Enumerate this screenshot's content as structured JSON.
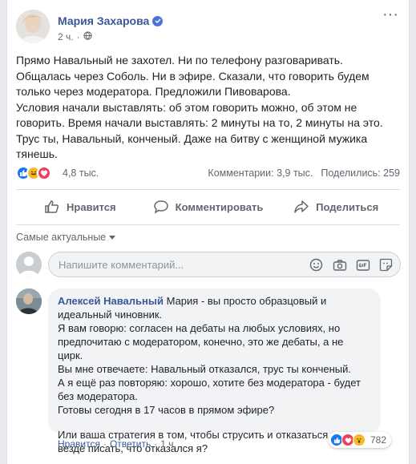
{
  "post": {
    "author": "Мария Захарова",
    "time": "2 ч.",
    "dot": "·",
    "more": "···",
    "text": "Прямо Навальный не захотел. Ни по телефону разговаривать. Общалась через Соболь. Ни в эфире. Сказали, что говорить будем только через модератора. Предложили Пивоварова.\nУсловия начали выставлять: об этом говорить можно, об этом не говорить. Время начали выставлять: 2 минуты на то, 2 минуты на это. Трус ты, Навальный, конченый. Даже на битву с женщиной мужика тянешь.",
    "reaction_count": "4,8 тыс.",
    "comments_count": "Комментарии: 3,9 тыс.",
    "shares_count": "Поделились: 259",
    "icons": [
      "like-icon",
      "laugh-icon",
      "love-icon",
      "verified-icon",
      "globe-icon"
    ],
    "colors": {
      "like": "#1877f2",
      "laugh": "#f7b928",
      "love": "#f33e58",
      "author": "#385898"
    }
  },
  "actions": {
    "like": "Нравится",
    "comment": "Комментировать",
    "share": "Поделиться"
  },
  "comments": {
    "sort_label": "Самые актуальные",
    "input_placeholder": "Напишите комментарий...",
    "input_icons": [
      "emoji-icon",
      "camera-icon",
      "gif-icon",
      "sticker-icon"
    ],
    "items": [
      {
        "author": "Алексей Навальный",
        "text": "Мария - вы просто образцовый и идеальный чиновник.\nЯ вам говорю: согласен на дебаты на любых условиях, но предпочитаю с модератором, конечно, это же дебаты, а не цирк.\nВы мне отвечаете: Навальный отказался, трус ты конченый.\nА я ещё раз повторяю: хорошо, хотите без модератора - будет без модератора.\nГотовы сегодня в 17 часов в прямом эфире?",
        "text2": "Или ваша стратегия в том, чтобы струсить и отказаться, но везде писать, что отказался я?",
        "like_link": "Нравится",
        "reply_link": "Ответить",
        "time": "1 ч.",
        "dot": "·",
        "reaction_count": "782"
      }
    ]
  }
}
